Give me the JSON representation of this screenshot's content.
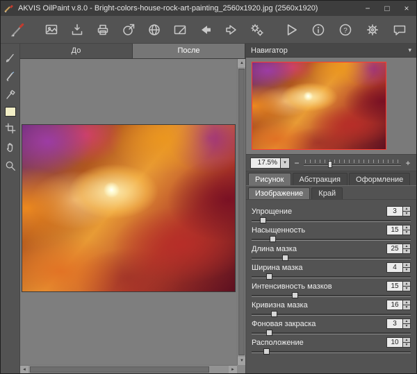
{
  "titlebar": {
    "title": "AKVIS OilPaint v.8.0 - Bright-colors-house-rock-art-painting_2560x1920.jpg (2560x1920)",
    "minimize": "−",
    "maximize": "□",
    "close": "×"
  },
  "icons": {
    "dropdown": "▾",
    "combo_caret": "▾",
    "minus": "−",
    "plus": "+",
    "spin_up": "▲",
    "spin_down": "▼",
    "scroll_left": "◄",
    "scroll_right": "►",
    "scroll_up": "▲",
    "scroll_down": "▼"
  },
  "toolbar": {
    "left_icons": [
      "app-brush",
      "open-image",
      "save-image",
      "print",
      "share",
      "web",
      "postcard",
      "back",
      "forward",
      "batch-gears"
    ],
    "right_icons": [
      "run",
      "info",
      "help",
      "preferences",
      "feedback"
    ]
  },
  "left_tools": [
    "brush-tool",
    "smudge-tool",
    "history-brush-tool",
    "color-swatch",
    "crop-tool",
    "hand-tool",
    "zoom-tool"
  ],
  "view_tabs": {
    "before": "До",
    "after": "После"
  },
  "navigator": {
    "title": "Навигатор",
    "zoom_value": "17.5%",
    "zoom_slider_percent": 25
  },
  "settings": {
    "tabs": [
      {
        "label": "Рисунок"
      },
      {
        "label": "Абстракция"
      },
      {
        "label": "Оформление"
      }
    ],
    "sub_tabs": [
      {
        "label": "Изображение"
      },
      {
        "label": "Край"
      }
    ],
    "params": [
      {
        "label": "Упрощение",
        "value": 3,
        "slider_percent": 7
      },
      {
        "label": "Насыщенность",
        "value": 15,
        "slider_percent": 13
      },
      {
        "label": "Длина мазка",
        "value": 25,
        "slider_percent": 21
      },
      {
        "label": "Ширина мазка",
        "value": 4,
        "slider_percent": 11
      },
      {
        "label": "Интенсивность мазков",
        "value": 15,
        "slider_percent": 27
      },
      {
        "label": "Кривизна мазка",
        "value": 16,
        "slider_percent": 14
      },
      {
        "label": "Фоновая закраска",
        "value": 3,
        "slider_percent": 11
      },
      {
        "label": "Расположение",
        "value": 10,
        "slider_percent": 9
      }
    ]
  },
  "colors": {
    "panel": "#535353",
    "canvas_bg": "#7e7e7e",
    "navigator_frame": "#ff3b30"
  }
}
